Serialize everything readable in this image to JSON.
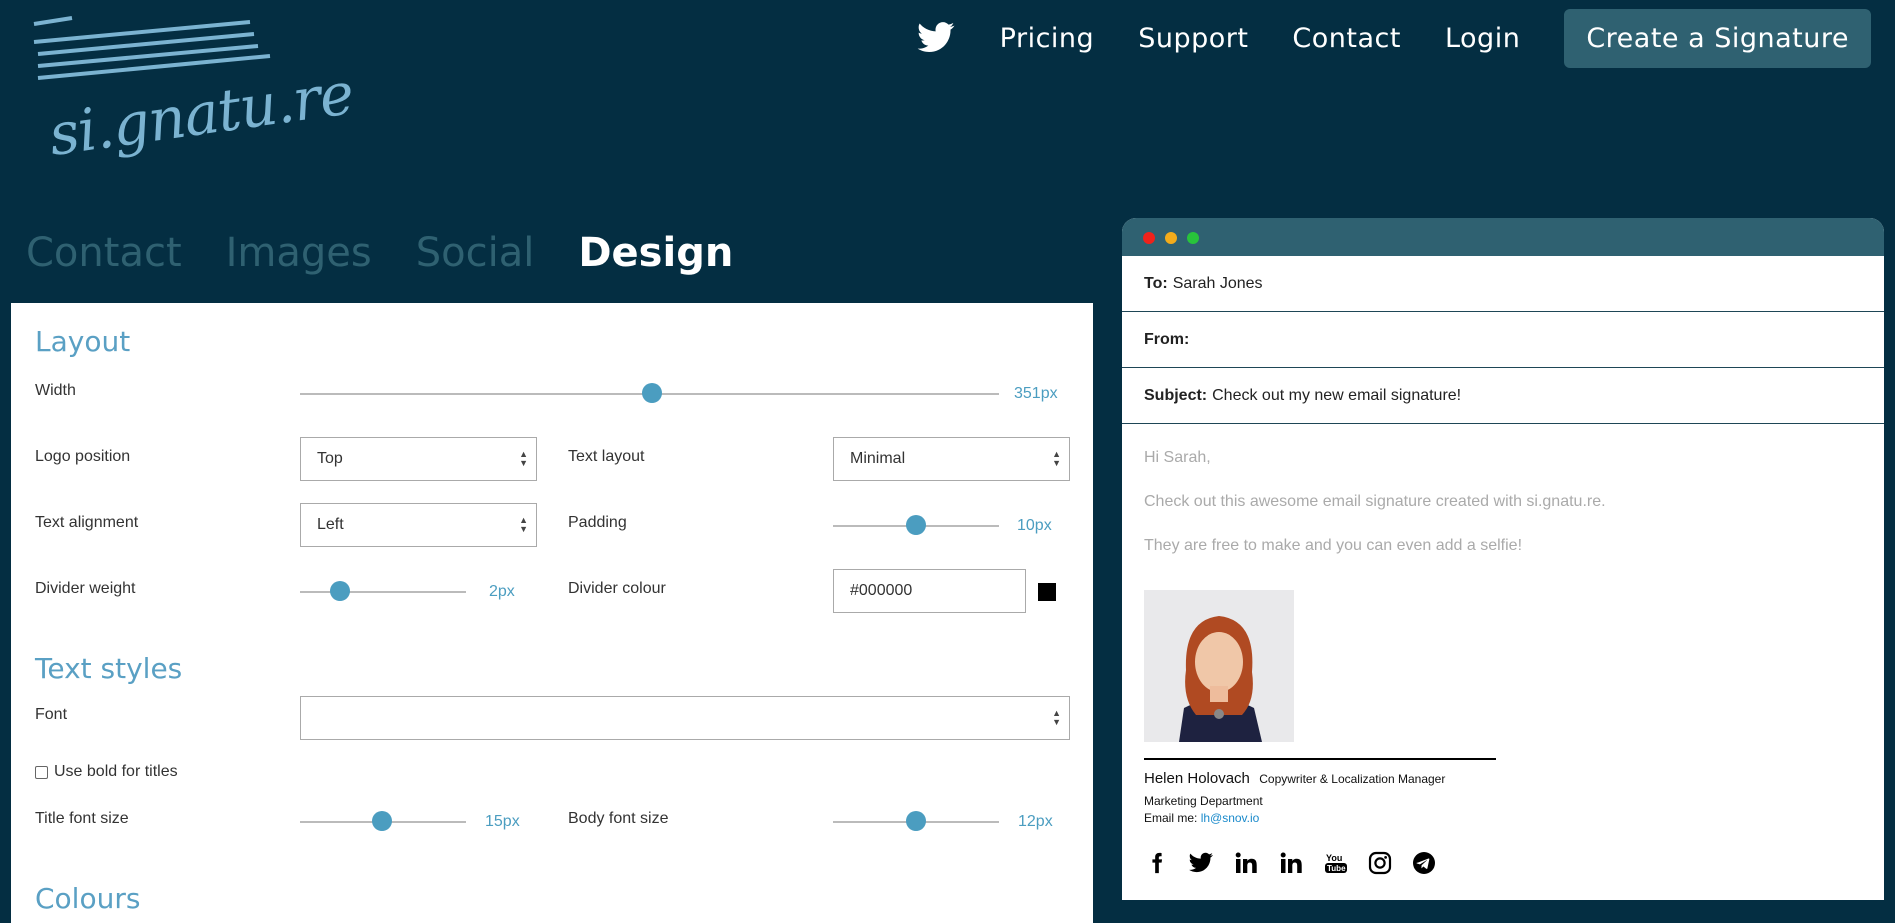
{
  "brand": {
    "logo_text": "si.gnatu.re"
  },
  "nav": {
    "items": [
      "Pricing",
      "Support",
      "Contact",
      "Login"
    ],
    "cta": "Create a Signature"
  },
  "tabs": [
    "Contact",
    "Images",
    "Social",
    "Design"
  ],
  "active_tab": "Design",
  "layout": {
    "title": "Layout",
    "width_label": "Width",
    "width_value": "351px",
    "logo_position_label": "Logo position",
    "logo_position_value": "Top",
    "text_layout_label": "Text layout",
    "text_layout_value": "Minimal",
    "text_alignment_label": "Text alignment",
    "text_alignment_value": "Left",
    "padding_label": "Padding",
    "padding_value": "10px",
    "divider_weight_label": "Divider weight",
    "divider_weight_value": "2px",
    "divider_colour_label": "Divider colour",
    "divider_colour_value": "#000000"
  },
  "text_styles": {
    "title": "Text styles",
    "font_label": "Font",
    "font_value": "",
    "bold_label": "Use bold for titles",
    "title_size_label": "Title font size",
    "title_size_value": "15px",
    "body_size_label": "Body font size",
    "body_size_value": "12px"
  },
  "colours": {
    "title": "Colours"
  },
  "email": {
    "to_label": "To:",
    "to_value": "Sarah Jones",
    "from_label": "From:",
    "from_value": "",
    "subject_label": "Subject:",
    "subject_value": "Check out my new email signature!",
    "line1": "Hi Sarah,",
    "line2": "Check out this awesome email signature created with si.gnatu.re.",
    "line3": "They are free to make and you can even add a selfie!"
  },
  "signature": {
    "name": "Helen Holovach",
    "title": "Copywriter & Localization Manager",
    "department": "Marketing Department",
    "email_label": "Email me:",
    "email": "lh@snov.io",
    "social_icons": [
      "facebook-icon",
      "twitter-icon",
      "linkedin-icon",
      "linkedin-icon",
      "youtube-icon",
      "instagram-icon",
      "telegram-icon"
    ]
  },
  "colors": {
    "bg": "#042e42",
    "accent": "#4b9dc0",
    "bar": "#2f6171"
  }
}
